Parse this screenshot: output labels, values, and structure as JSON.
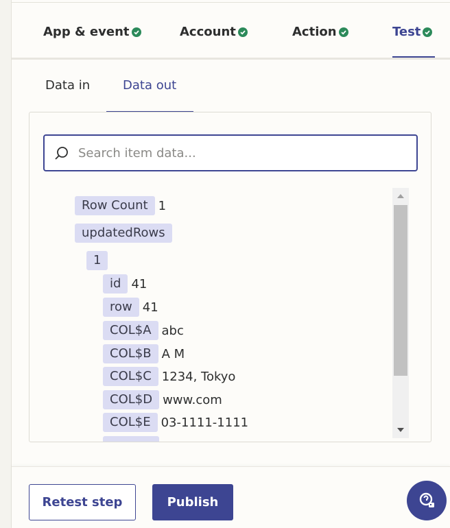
{
  "step_tabs": [
    {
      "label": "App & event",
      "complete": true
    },
    {
      "label": "Account",
      "complete": true
    },
    {
      "label": "Action",
      "complete": true
    },
    {
      "label": "Test",
      "complete": true
    }
  ],
  "sub_tabs": {
    "data_in": "Data in",
    "data_out": "Data out"
  },
  "search": {
    "placeholder": "Search item data..."
  },
  "tree": {
    "row_count": {
      "key": "Row Count",
      "value": "1"
    },
    "updated_rows": {
      "key": "updatedRows"
    },
    "item_index": {
      "key": "1"
    },
    "fields": [
      {
        "key": "id",
        "value": "41"
      },
      {
        "key": "row",
        "value": "41"
      },
      {
        "key": "COL$A",
        "value": "abc"
      },
      {
        "key": "COL$B",
        "value": "A M"
      },
      {
        "key": "COL$C",
        "value": "1234, Tokyo"
      },
      {
        "key": "COL$D",
        "value": "www.com"
      },
      {
        "key": "COL$E",
        "value": "03-1111-1111"
      },
      {
        "key": "COL$F",
        "value": ""
      }
    ]
  },
  "footer": {
    "retest_label": "Retest step",
    "publish_label": "Publish"
  },
  "colors": {
    "accent": "#3d4592",
    "check": "#2c8a5a",
    "key_bg": "#dbdcf3"
  }
}
